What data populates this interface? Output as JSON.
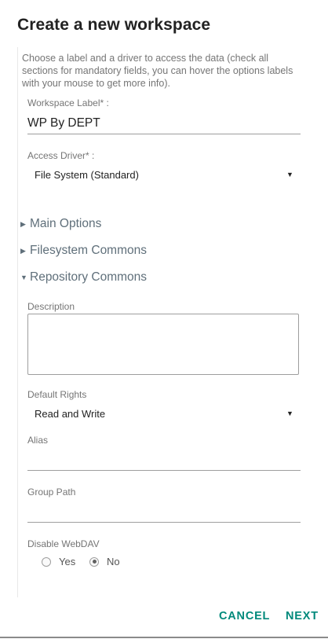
{
  "dialog": {
    "title": "Create a new workspace",
    "intro": "Choose a label and a driver to access the data (check all sections for mandatory fields, you can hover the options labels with your mouse to get more info)."
  },
  "form": {
    "workspace_label": {
      "label": "Workspace Label* :",
      "value": "WP By DEPT"
    },
    "access_driver": {
      "label": "Access Driver* :",
      "selected": "File System (Standard)"
    },
    "sections": [
      {
        "label": "Main Options",
        "expanded": false
      },
      {
        "label": "Filesystem Commons",
        "expanded": false
      },
      {
        "label": "Repository Commons",
        "expanded": true
      }
    ],
    "description": {
      "label": "Description",
      "value": ""
    },
    "default_rights": {
      "label": "Default Rights",
      "selected": "Read and Write"
    },
    "alias": {
      "label": "Alias",
      "value": ""
    },
    "group_path": {
      "label": "Group Path",
      "value": ""
    },
    "disable_webdav": {
      "label": "Disable WebDAV",
      "options": [
        "Yes",
        "No"
      ],
      "selected": "No"
    }
  },
  "actions": {
    "cancel": "CANCEL",
    "next": "NEXT"
  },
  "colors": {
    "accent": "#00897b",
    "section_text": "#5f6f7a",
    "label_text": "#757575"
  }
}
